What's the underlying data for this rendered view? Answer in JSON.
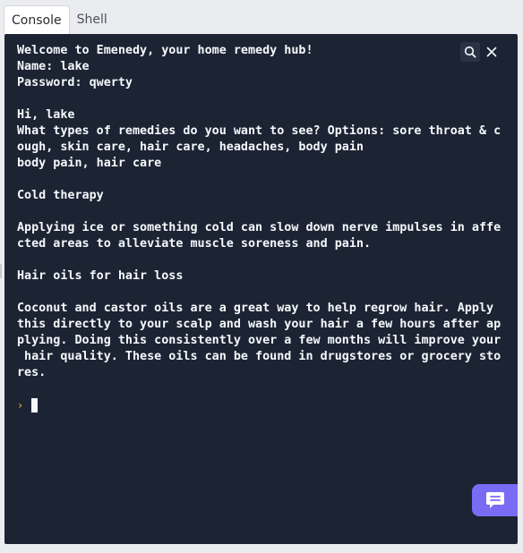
{
  "tabs": [
    {
      "label": "Console",
      "active": true
    },
    {
      "label": "Shell",
      "active": false
    }
  ],
  "console": {
    "lines": [
      "Welcome to Emenedy, your home remedy hub!",
      "Name: lake",
      "Password: qwerty",
      "",
      "Hi, lake",
      "What types of remedies do you want to see? Options: sore throat & c",
      "ough, skin care, hair care, headaches, body pain",
      "body pain, hair care",
      "",
      "Cold therapy",
      "",
      "Applying ice or something cold can slow down nerve impulses in affe",
      "cted areas to alleviate muscle soreness and pain.",
      "",
      "Hair oils for hair loss",
      "",
      "Coconut and castor oils are a great way to help regrow hair. Apply",
      "this directly to your scalp and wash your hair a few hours after ap",
      "plying. Doing this consistently over a few months will improve your",
      " hair quality. These oils can be found in drugstores or grocery sto",
      "res."
    ],
    "prompt_glyph": "›"
  },
  "icons": {
    "search": "search-icon",
    "close": "close-icon",
    "chat": "chat-bubble-icon"
  },
  "colors": {
    "console_bg": "#1c2333",
    "text": "#f5f9fc",
    "prompt": "#c9a32b",
    "chat_button": "#7a6bf5"
  }
}
